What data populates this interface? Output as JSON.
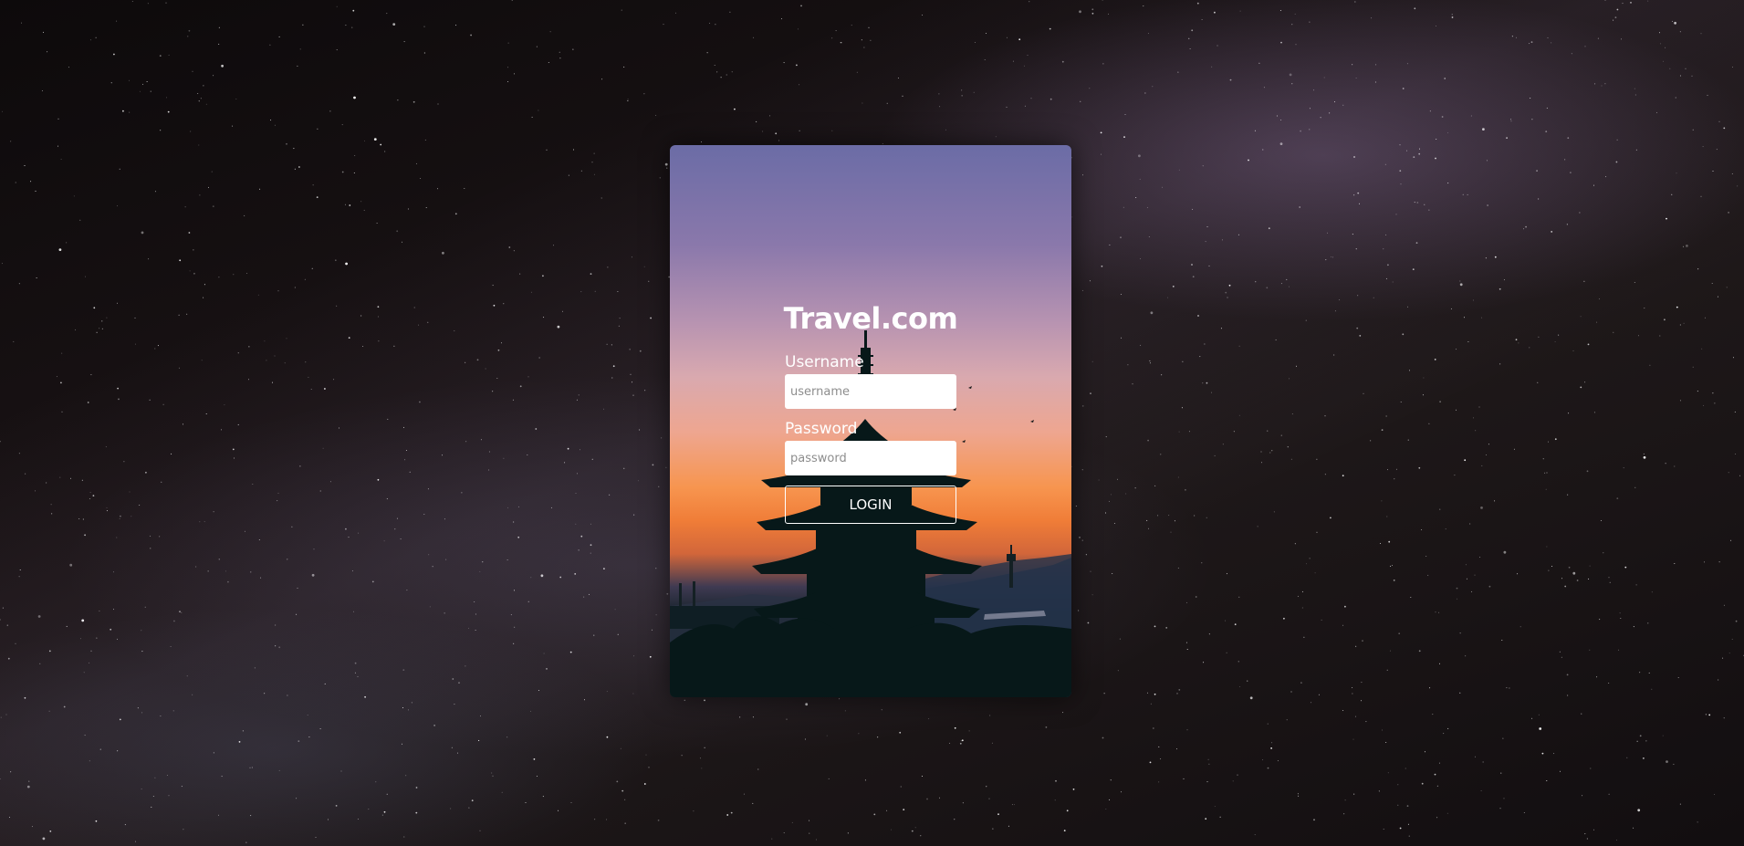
{
  "login": {
    "brand": "Travel.com",
    "username_label": "Username",
    "username_placeholder": "username",
    "password_label": "Password",
    "password_placeholder": "password",
    "button_label": "LOGIN"
  }
}
